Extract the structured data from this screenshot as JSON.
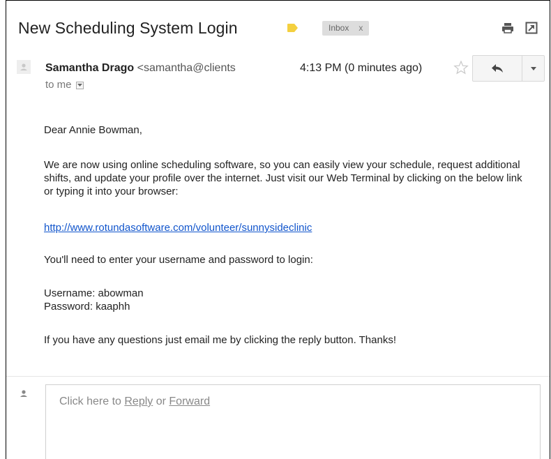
{
  "thread": {
    "subject": "New Scheduling System Login",
    "label_color": "#f4d03f",
    "inbox_label": "Inbox",
    "inbox_close": "x"
  },
  "toolbar": {
    "print_icon": "print-icon",
    "new_window_icon": "new-window-icon"
  },
  "message": {
    "sender_name": "Samantha Drago",
    "sender_email": "<samantha@clients",
    "timestamp": "4:13 PM (0 minutes ago)",
    "to_label": "to me",
    "body": {
      "greeting": "Dear Annie Bowman,",
      "intro": "We are now using online scheduling software, so you can easily view your schedule, request additional shifts, and update your profile over the internet. Just visit our Web Terminal by clicking on the below link or typing it into your browser:",
      "link": "http://www.rotundasoftware.com/volunteer/sunnysideclinic",
      "need_login": "You'll need to enter your username and password to login:",
      "username_line": "Username: abowman",
      "password_line": "Password: kaaphh",
      "closing": "If you have any questions just email me by clicking the reply button. Thanks!"
    }
  },
  "reply_box": {
    "prefix": "Click here to ",
    "reply_link": "Reply",
    "middle": " or ",
    "forward_link": "Forward"
  },
  "colors": {
    "link": "#1155cc",
    "button_bg": "#f5f5f5",
    "chip_bg": "#dddddd"
  }
}
